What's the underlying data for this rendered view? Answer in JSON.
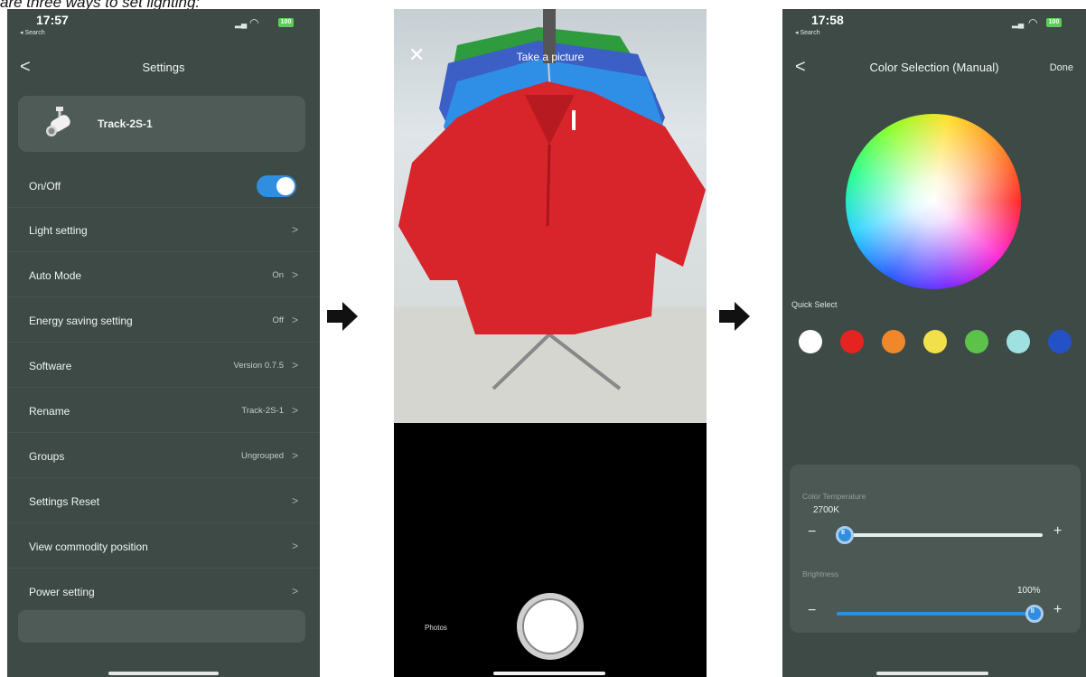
{
  "caption": "are three ways to set lighting:",
  "phone1": {
    "status": {
      "time": "17:57",
      "back_app": "◂ Search",
      "battery": "100"
    },
    "nav": {
      "back": "<",
      "title": "Settings"
    },
    "device": {
      "name": "Track-2S-1",
      "icon": "track-light-icon"
    },
    "onoff": {
      "label": "On/Off",
      "state": "on"
    },
    "rows": [
      {
        "label": "Light setting",
        "value": ""
      },
      {
        "label": "Auto Mode",
        "value": "On"
      },
      {
        "label": "Energy saving setting",
        "value": "Off"
      },
      {
        "label": "Software",
        "value": "Version 0.7.5"
      },
      {
        "label": "Rename",
        "value": "Track-2S-1"
      },
      {
        "label": "Groups",
        "value": "Ungrouped"
      },
      {
        "label": "Settings Reset",
        "value": ""
      },
      {
        "label": "View commodity position",
        "value": ""
      },
      {
        "label": "Power setting",
        "value": ""
      }
    ],
    "chevron": ">"
  },
  "phone2": {
    "close": "✕",
    "title": "Take a picture",
    "photos_label": "Photos"
  },
  "phone3": {
    "status": {
      "time": "17:58",
      "back_app": "◂ Search",
      "battery": "100"
    },
    "nav": {
      "back": "<",
      "title": "Color Selection (Manual)",
      "done": "Done"
    },
    "quick_select_label": "Quick Select",
    "swatches": [
      "#ffffff",
      "#e52321",
      "#f0872a",
      "#f2e04a",
      "#5cc24a",
      "#9fe0e0",
      "#2452c6",
      "#c35ac8"
    ],
    "color_temperature": {
      "label": "Color Temperature",
      "value": "2700K",
      "level": 0
    },
    "brightness": {
      "label": "Brightness",
      "value": "100%",
      "level": 100
    },
    "minus": "−",
    "plus": "+"
  },
  "colors": {
    "accent": "#2f8ee0",
    "panel": "#3d4a45",
    "card": "#4e5b56"
  }
}
